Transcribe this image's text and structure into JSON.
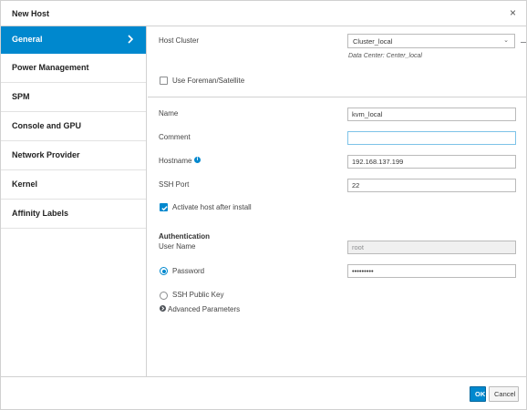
{
  "dialog": {
    "title": "New Host",
    "close_glyph": "×"
  },
  "sidebar": {
    "items": [
      {
        "label": "General",
        "active": true
      },
      {
        "label": "Power Management"
      },
      {
        "label": "SPM"
      },
      {
        "label": "Console and GPU"
      },
      {
        "label": "Network Provider"
      },
      {
        "label": "Kernel"
      },
      {
        "label": "Affinity Labels"
      }
    ]
  },
  "general": {
    "host_cluster_label": "Host Cluster",
    "host_cluster_value": "Cluster_local",
    "data_center_text": "Data Center: Center_local",
    "use_foreman_label": "Use Foreman/Satellite",
    "use_foreman_checked": false,
    "name_label": "Name",
    "name_value": "kvm_local",
    "comment_label": "Comment",
    "comment_value": "",
    "hostname_label": "Hostname",
    "hostname_value": "192.168.137.199",
    "ssh_port_label": "SSH Port",
    "ssh_port_value": "22",
    "activate_label": "Activate host after install",
    "activate_checked": true,
    "authentication_heading": "Authentication",
    "user_name_label": "User Name",
    "user_name_value": "root",
    "password_label": "Password",
    "password_value": "•••••••••",
    "password_selected": true,
    "ssh_public_key_label": "SSH Public Key",
    "advanced_parameters_label": "Advanced Parameters"
  },
  "footer": {
    "ok_label": "OK",
    "cancel_label": "Cancel"
  },
  "colors": {
    "accent": "#0088ce",
    "border": "#d1d1d1"
  },
  "icons": {
    "close": "close-icon",
    "chevron": "chevron-right-icon",
    "caret": "chevron-down-icon",
    "info": "info-icon",
    "expander": "expand-arrow-icon"
  }
}
